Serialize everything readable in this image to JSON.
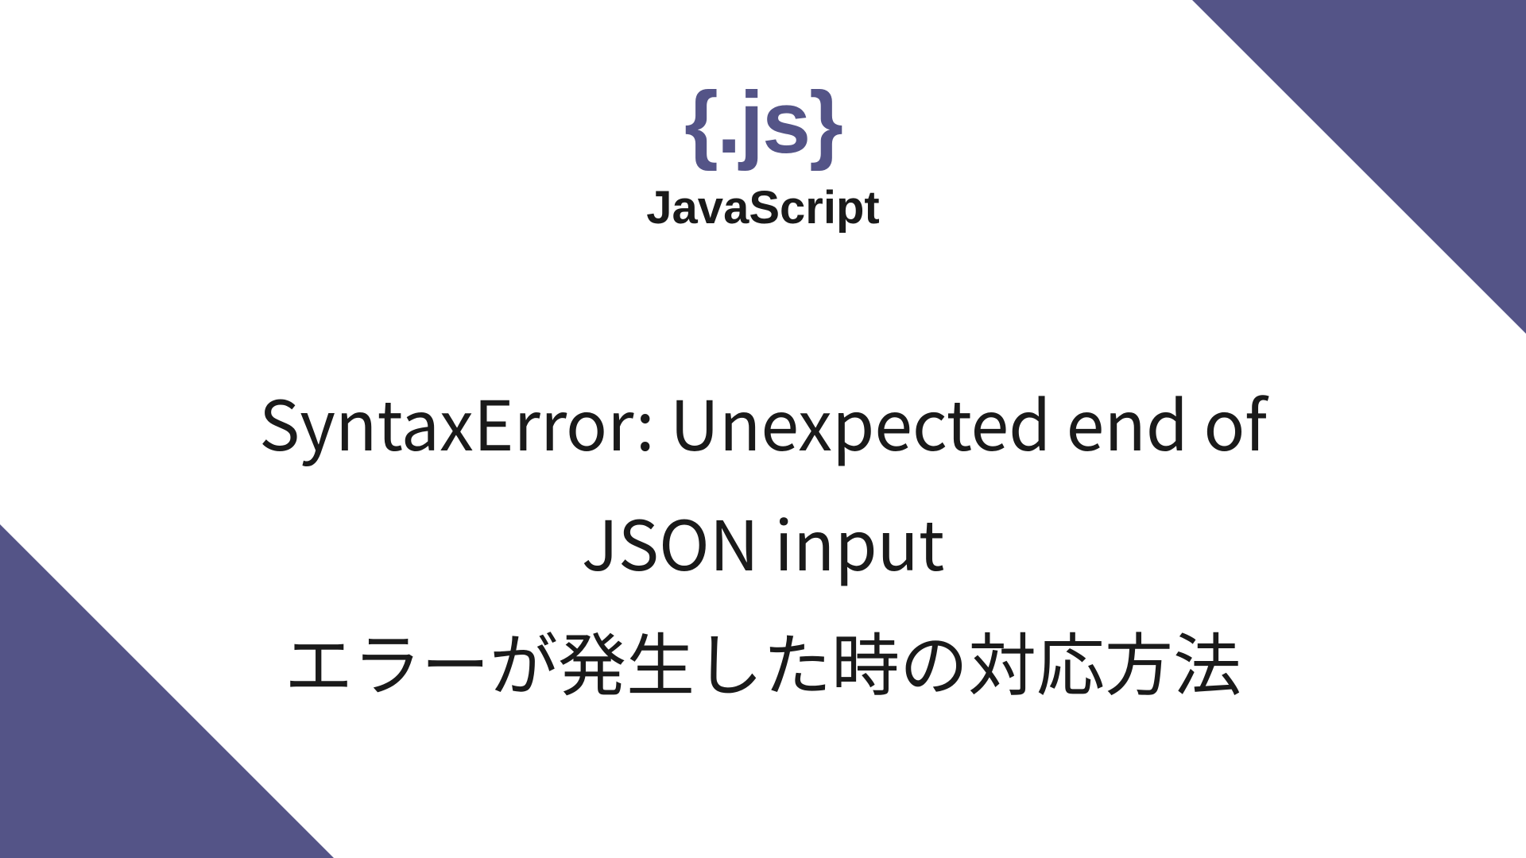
{
  "logo": {
    "braces": "{.js}",
    "text": "JavaScript"
  },
  "title": {
    "line1": "SyntaxError: Unexpected end of",
    "line2": "JSON input",
    "line3": "エラーが発生した時の対応方法"
  },
  "colors": {
    "accent": "#545487",
    "background": "#ffffff",
    "text": "#1a1a1a"
  }
}
